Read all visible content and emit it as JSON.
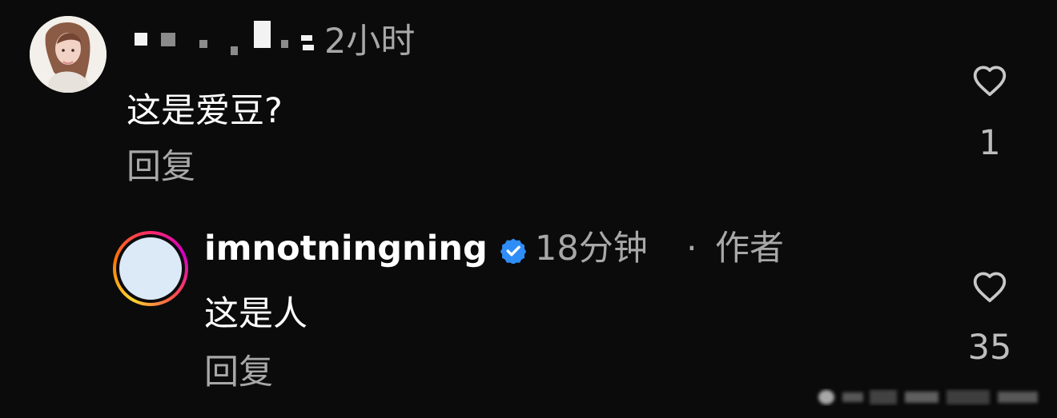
{
  "comment": {
    "time": "2小时",
    "text": "这是爱豆?",
    "reply_label": "回复",
    "likes": "1"
  },
  "reply": {
    "username": "imnotningning",
    "time": "18分钟",
    "separator": "·",
    "author_badge": "作者",
    "text": "这是人",
    "reply_label": "回复",
    "likes": "35"
  },
  "icons": {
    "heart": "heart-icon",
    "verified": "verified-badge-icon"
  },
  "colors": {
    "background": "#0b0b0c",
    "primary_text": "#ffffff",
    "secondary_text": "#a8a8a8",
    "verified_blue": "#2f8df8"
  }
}
